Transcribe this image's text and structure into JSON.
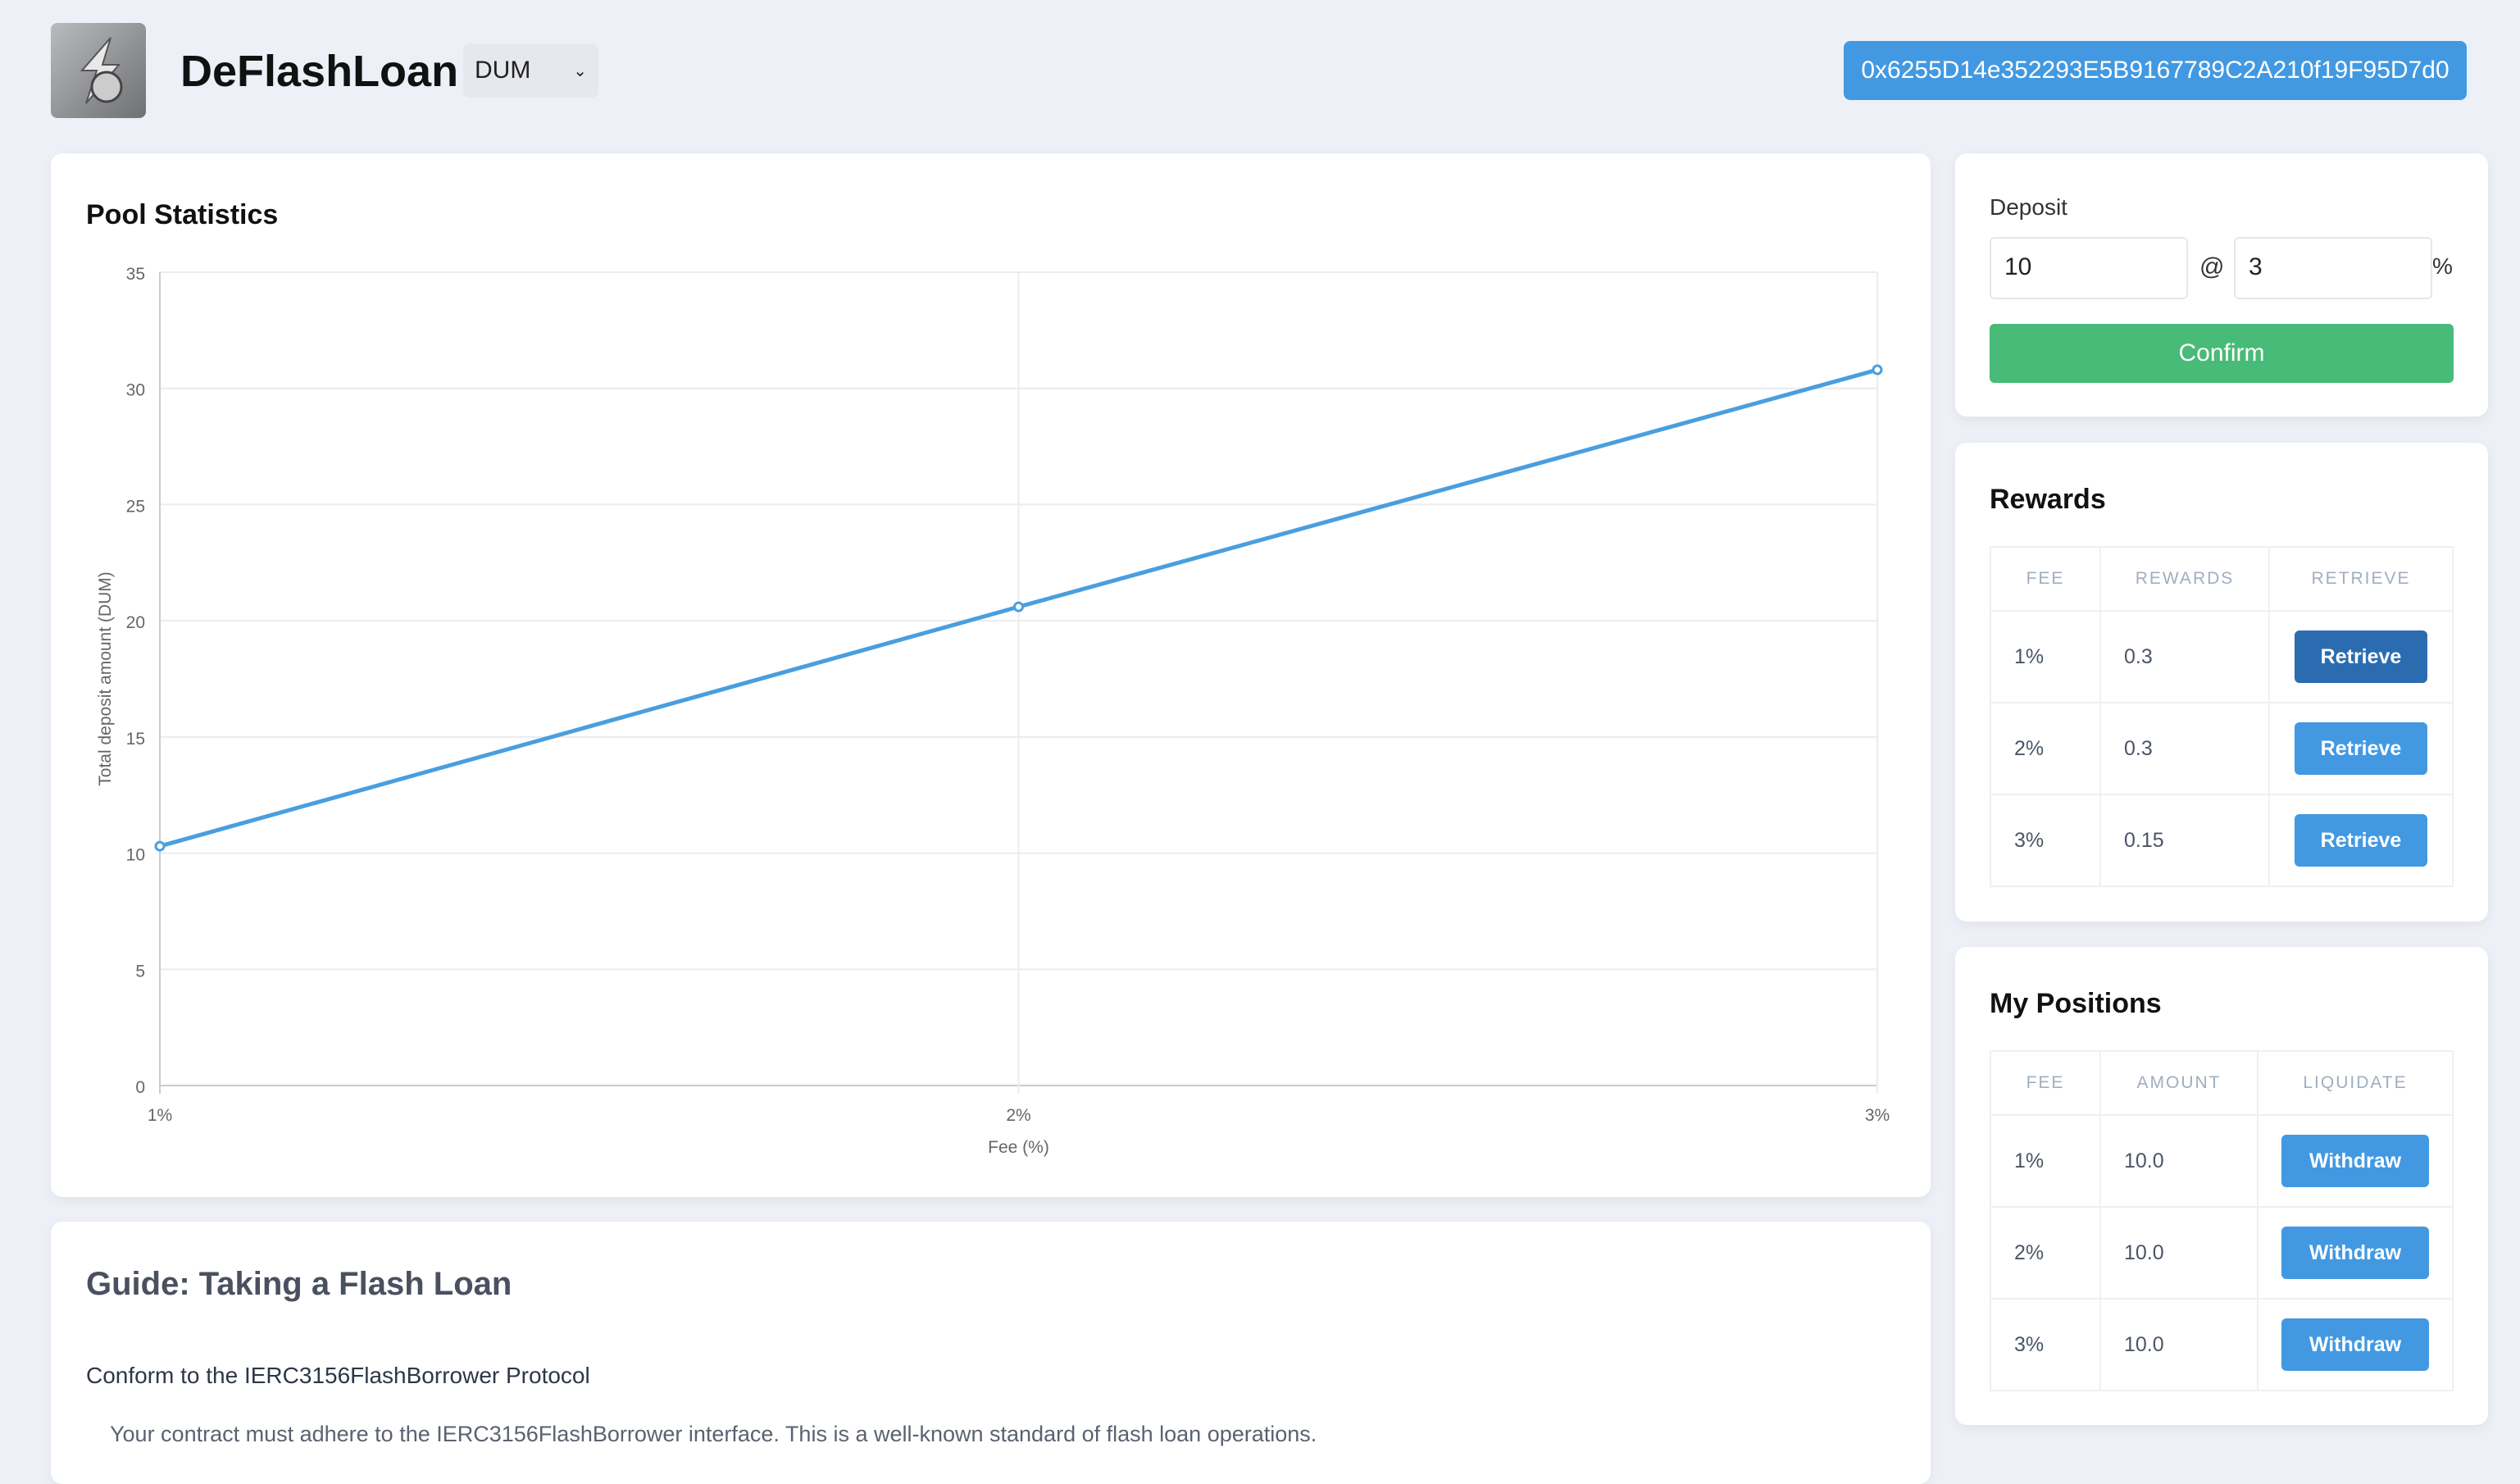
{
  "header": {
    "title": "DeFlashLoan",
    "token": "DUM",
    "address": "0x6255D14e352293E5B9167789C2A210f19F95D7d0"
  },
  "pool": {
    "title": "Pool Statistics"
  },
  "chart_data": {
    "type": "line",
    "title": "",
    "xlabel": "Fee (%)",
    "ylabel": "Total deposit amount (DUM)",
    "categories": [
      "1%",
      "2%",
      "3%"
    ],
    "values": [
      10.3,
      20.6,
      30.8
    ],
    "ylim": [
      0,
      35
    ],
    "yticks": [
      "0",
      "5",
      "10",
      "15",
      "20",
      "25",
      "30",
      "35"
    ],
    "grid": true,
    "color": "#4a9ede"
  },
  "deposit": {
    "label": "Deposit",
    "amount": "10",
    "at": "@",
    "fee": "3",
    "percent": "%",
    "confirm": "Confirm"
  },
  "rewards": {
    "title": "Rewards",
    "headers": [
      "FEE",
      "REWARDS",
      "RETRIEVE"
    ],
    "rows": [
      {
        "fee": "1%",
        "rewards": "0.3",
        "action": "Retrieve"
      },
      {
        "fee": "2%",
        "rewards": "0.3",
        "action": "Retrieve"
      },
      {
        "fee": "3%",
        "rewards": "0.15",
        "action": "Retrieve"
      }
    ]
  },
  "positions": {
    "title": "My Positions",
    "headers": [
      "FEE",
      "AMOUNT",
      "LIQUIDATE"
    ],
    "rows": [
      {
        "fee": "1%",
        "amount": "10.0",
        "action": "Withdraw"
      },
      {
        "fee": "2%",
        "amount": "10.0",
        "action": "Withdraw"
      },
      {
        "fee": "3%",
        "amount": "10.0",
        "action": "Withdraw"
      }
    ]
  },
  "guide": {
    "title": "Guide: Taking a Flash Loan",
    "step1": "Conform to the IERC3156FlashBorrower Protocol",
    "step1_text": "Your contract must adhere to the IERC3156FlashBorrower interface. This is a well-known standard of flash loan operations."
  }
}
